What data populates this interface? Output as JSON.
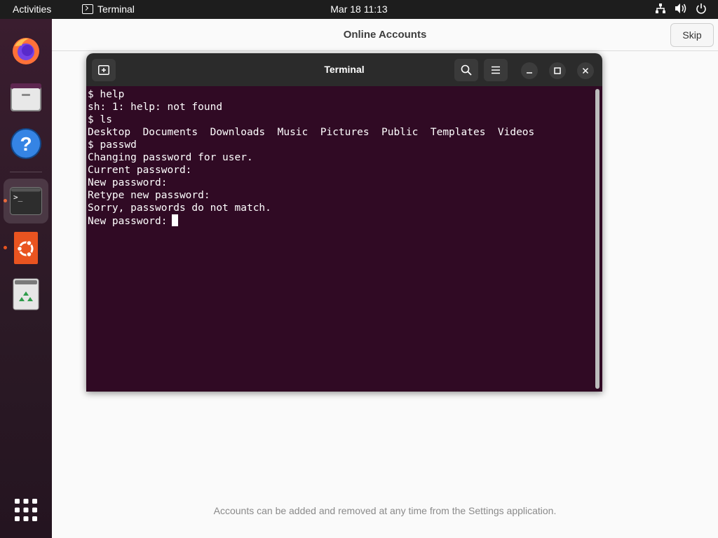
{
  "topbar": {
    "activities": "Activities",
    "app_name": "Terminal",
    "clock": "Mar 18  11:13",
    "icons": [
      "network-icon",
      "volume-icon",
      "power-icon"
    ]
  },
  "dock": {
    "items": [
      {
        "name": "firefox",
        "icon": "firefox-icon"
      },
      {
        "name": "files",
        "icon": "files-icon"
      },
      {
        "name": "help",
        "icon": "help-icon",
        "glyph": "?"
      },
      {
        "name": "terminal",
        "icon": "terminal-icon",
        "glyph": ">_",
        "active": true
      },
      {
        "name": "software",
        "icon": "ubuntu-software-icon"
      },
      {
        "name": "trash",
        "icon": "trash-icon"
      },
      {
        "name": "show-apps",
        "icon": "app-grid-icon"
      }
    ]
  },
  "online_accounts": {
    "title": "Online Accounts",
    "skip_label": "Skip",
    "footer": "Accounts can be added and removed at any time from the Settings application."
  },
  "terminal": {
    "title": "Terminal",
    "lines": [
      "$ help",
      "sh: 1: help: not found",
      "$ ls",
      "Desktop  Documents  Downloads  Music  Pictures  Public  Templates  Videos",
      "$ passwd",
      "Changing password for user.",
      "Current password:",
      "New password:",
      "Retype new password:",
      "Sorry, passwords do not match.",
      "New password:"
    ]
  },
  "colors": {
    "accent": "#e95420",
    "terminal_bg": "#300a24",
    "topbar_bg": "#1d1d1d"
  }
}
